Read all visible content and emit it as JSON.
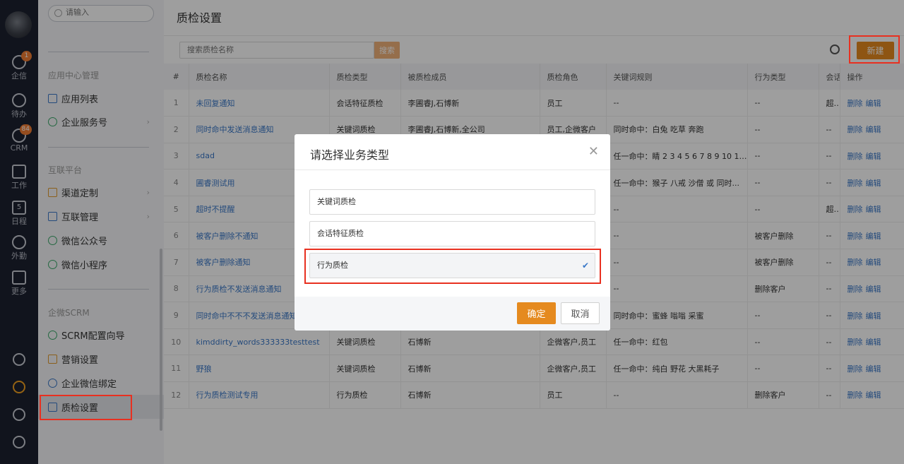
{
  "rail": {
    "items": [
      {
        "label": "企信",
        "icon": "chat-icon",
        "badge": "1"
      },
      {
        "label": "待办",
        "icon": "check-circle-icon",
        "badge": ""
      },
      {
        "label": "CRM",
        "icon": "crm-icon",
        "badge": "84"
      },
      {
        "label": "工作",
        "icon": "briefcase-icon",
        "badge": ""
      },
      {
        "label": "日程",
        "icon": "calendar-icon",
        "badge": "",
        "day": "5"
      },
      {
        "label": "外勤",
        "icon": "location-icon",
        "badge": ""
      },
      {
        "label": "更多",
        "icon": "grid-icon",
        "badge": ""
      }
    ],
    "bottom": [
      "help-icon",
      "settings-icon",
      "history-icon",
      "user-list-icon"
    ]
  },
  "sidebar": {
    "search_placeholder": "请输入",
    "sections": [
      {
        "title": "应用中心管理",
        "items": [
          {
            "label": "应用列表",
            "arrow": false
          },
          {
            "label": "企业服务号",
            "arrow": true
          }
        ]
      },
      {
        "title": "互联平台",
        "items": [
          {
            "label": "渠道定制",
            "arrow": true
          },
          {
            "label": "互联管理",
            "arrow": true
          },
          {
            "label": "微信公众号",
            "arrow": false
          },
          {
            "label": "微信小程序",
            "arrow": false
          }
        ]
      },
      {
        "title": "企微SCRM",
        "items": [
          {
            "label": "SCRM配置向导",
            "arrow": false
          },
          {
            "label": "营销设置",
            "arrow": false
          },
          {
            "label": "企业微信绑定",
            "arrow": false
          },
          {
            "label": "质检设置",
            "arrow": false
          }
        ]
      }
    ],
    "collapse": "«"
  },
  "main": {
    "title": "质检设置",
    "search_placeholder": "搜索质检名称",
    "search_button": "搜索",
    "new_button": "新建",
    "columns": [
      "#",
      "质检名称",
      "质检类型",
      "被质检成员",
      "质检角色",
      "关键词规则",
      "行为类型",
      "会话",
      "操作"
    ],
    "rows": [
      [
        "1",
        "未回复通知",
        "会话特征质检",
        "李圃睿J,石博新",
        "员工",
        "--",
        "--",
        "超时"
      ],
      [
        "2",
        "同时命中发送消息通知",
        "关键词质检",
        "李圃睿J,石博新,全公司",
        "员工,企微客户",
        "同时命中：白兔 吃草 奔跑",
        "--",
        "--"
      ],
      [
        "3",
        "sdad",
        "",
        "",
        "",
        "任一命中：睛 2 3 4 5 6 7 8 9 10 11 ...",
        "--",
        "--"
      ],
      [
        "4",
        "圃睿测试用",
        "",
        "",
        "",
        "任一命中：猴子 八戒 沙僧 或 同时...",
        "--",
        "--"
      ],
      [
        "5",
        "超时不提醒",
        "",
        "",
        "",
        "--",
        "--",
        "超时"
      ],
      [
        "6",
        "被客户删除不通知",
        "",
        "",
        "",
        "--",
        "被客户删除",
        "--"
      ],
      [
        "7",
        "被客户删除通知",
        "",
        "",
        "",
        "--",
        "被客户删除",
        "--"
      ],
      [
        "8",
        "行为质检不发送消息通知",
        "",
        "",
        "",
        "--",
        "删除客户",
        "--"
      ],
      [
        "9",
        "同时命中不不不发送消息通知",
        "",
        "",
        "",
        "同时命中：蜜蜂 嗡嗡 采蜜",
        "--",
        "--"
      ],
      [
        "10",
        "kimddirty_words333333testtest",
        "关键词质检",
        "石博新",
        "企微客户,员工",
        "任一命中：红包",
        "--",
        "--"
      ],
      [
        "11",
        "野狼",
        "关键词质检",
        "石博新",
        "企微客户,员工",
        "任一命中：纯白 野花 大黑耗子",
        "--",
        "--"
      ],
      [
        "12",
        "行为质检测试专用",
        "行为质检",
        "石博新",
        "员工",
        "--",
        "删除客户",
        "--"
      ]
    ],
    "row_actions": [
      "删除",
      "编辑"
    ]
  },
  "modal": {
    "title": "请选择业务类型",
    "options": [
      "关键词质检",
      "会话特征质检",
      "行为质检"
    ],
    "selected_index": 2,
    "ok": "确定",
    "cancel": "取消"
  }
}
